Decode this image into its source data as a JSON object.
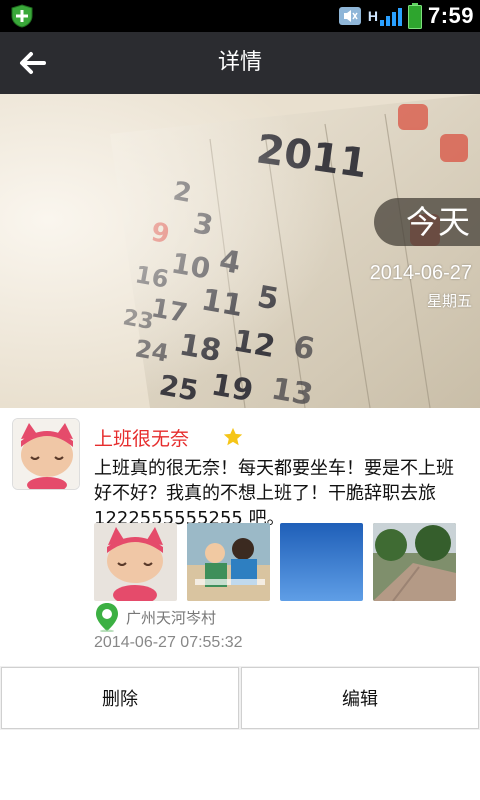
{
  "status_bar": {
    "time": "7:59",
    "network_label": "H",
    "icons": [
      "shield-plus-icon",
      "sound-muted-icon",
      "signal-icon",
      "battery-icon"
    ]
  },
  "header": {
    "title": "详情",
    "back_icon": "arrow-left-icon"
  },
  "hero": {
    "calendar_year": "2011",
    "calendar_numbers": [
      "2",
      "3",
      "4",
      "9",
      "10",
      "11",
      "16",
      "17",
      "18",
      "23",
      "24",
      "25",
      "5",
      "12",
      "19",
      "6",
      "13"
    ],
    "badge": "今天",
    "date": "2014-06-27",
    "weekday": "星期五"
  },
  "post": {
    "title": "上班很无奈",
    "starred": true,
    "body": "上班真的很无奈！每天都要坐车！要是不上班好不好？我真的不想上班了！干脆辞职去旅 1222555555255 吧。",
    "photo_names": [
      "photo-doll",
      "photo-children",
      "photo-sky",
      "photo-street"
    ],
    "location": "广州天河岑村",
    "timestamp": "2014-06-27 07:55:32"
  },
  "actions": {
    "delete_label": "删除",
    "edit_label": "编辑"
  },
  "colors": {
    "header_bg": "#2b2c30",
    "title_red": "#e62d2d",
    "star_yellow": "#f5c518",
    "location_green": "#3cb043"
  }
}
